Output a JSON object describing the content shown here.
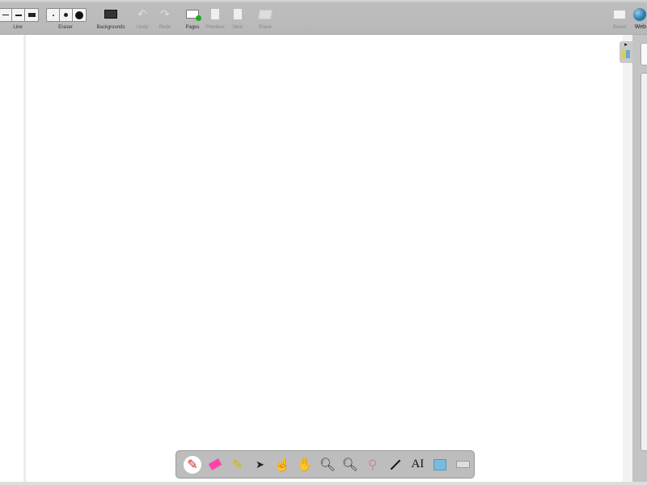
{
  "toolbar": {
    "line_label": "Line",
    "eraser_label": "Eraser",
    "backgrounds_label": "Backgrounds",
    "undo_label": "Undo",
    "redo_label": "Redo",
    "pages_label": "Pages",
    "previous_label": "Previous",
    "next_label": "Next",
    "erase_label": "Erase",
    "board_label": "Board",
    "web_label": "Web"
  },
  "dock": {
    "tools": [
      "pen",
      "eraser",
      "marker",
      "selector",
      "interactor",
      "hand",
      "zoom-in",
      "zoom-out",
      "laser-pointer",
      "line",
      "text",
      "capture",
      "virtual-keyboard"
    ],
    "text_glyph": "AI"
  },
  "colors": {
    "toolbar": "#b8b8b8",
    "board": "#ffffff",
    "active_tool": "#ffffff"
  }
}
